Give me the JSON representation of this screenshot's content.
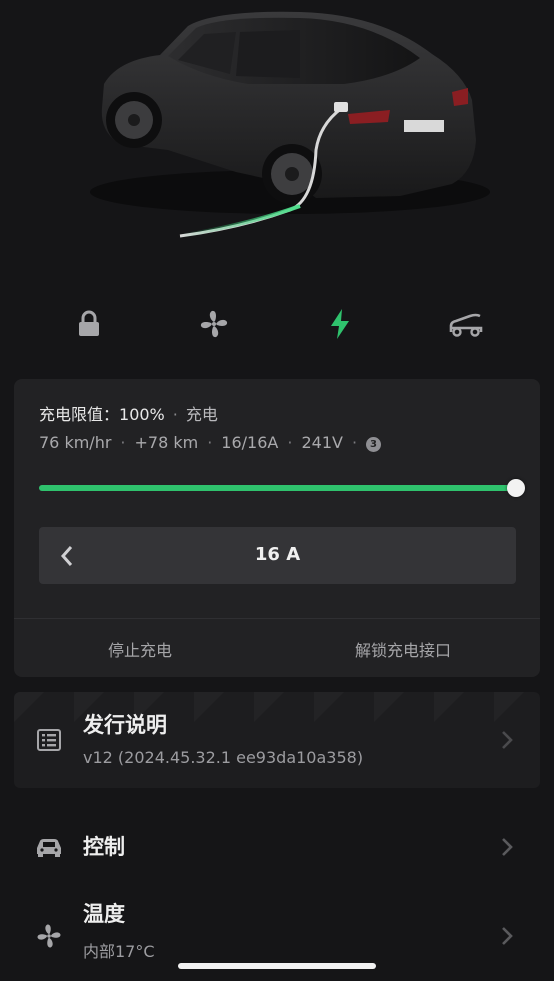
{
  "quick_controls": [
    {
      "name": "lock-icon"
    },
    {
      "name": "fan-icon"
    },
    {
      "name": "charging-bolt-icon",
      "active": true
    },
    {
      "name": "frunk-icon"
    }
  ],
  "charge": {
    "limit_label": "充电限值：",
    "limit_value": "100%",
    "mode": "充电",
    "rate": "76 km/hr",
    "added_range": "+78 km",
    "current": "16/16A",
    "voltage": "241V",
    "phase_badge": "3",
    "limit_level_percent": 100,
    "amps_value": "16 A",
    "stop_label": "停止充电",
    "unlock_label": "解锁充电接口",
    "accent": "#2fc26d"
  },
  "menu": {
    "release_notes": {
      "title": "发行说明",
      "subtitle": "v12 (2024.45.32.1 ee93da10a358)"
    },
    "controls": {
      "title": "控制"
    },
    "climate": {
      "title": "温度",
      "subtitle": "内部17°C"
    }
  }
}
